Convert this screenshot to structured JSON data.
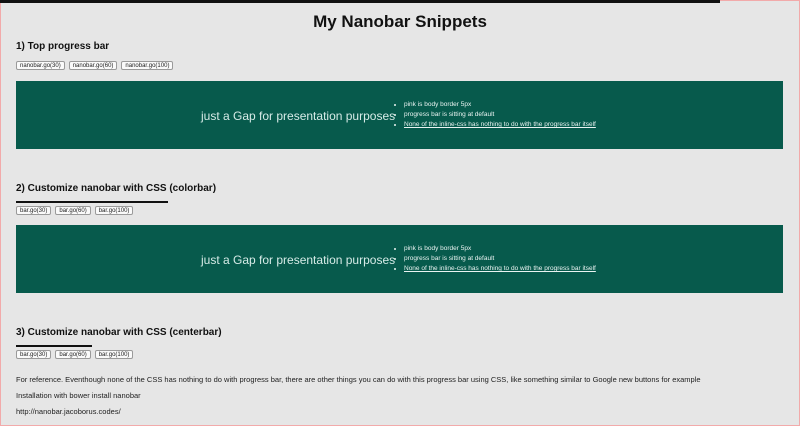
{
  "page": {
    "title": "My Nanobar Snippets",
    "top_nanobar_progress": 0.9
  },
  "sections": [
    {
      "heading": "1) Top progress bar",
      "buttons": [
        "nanobar.go(30)",
        "nanobar.go(60)",
        "nanobar.go(100)"
      ]
    },
    {
      "heading": "2) Customize nanobar with CSS (colorbar)",
      "buttons": [
        "bar.go(30)",
        "bar.go(60)",
        "bar.go(100)"
      ],
      "bar_progress": 0.2
    },
    {
      "heading": "3) Customize nanobar with CSS (centerbar)",
      "buttons": [
        "bar.go(30)",
        "bar.go(60)",
        "bar.go(100)"
      ],
      "bar_progress": 0.1
    }
  ],
  "panel": {
    "gap_text": "just a Gap for presentation purposes",
    "notes": [
      "pink is body border 5px",
      "progress bar is sitting at default",
      "None of the inline-css has nothing to do with the progress bar itself"
    ]
  },
  "footer": {
    "reference": "For reference. Eventhough none of the CSS has nothing to do with progress bar, there are other things you can do with this progress bar using CSS, like something similar to Google new buttons for example",
    "install": "Installation with bower install nanobar",
    "link": "http://nanobar.jacoborus.codes/"
  },
  "colors": {
    "panel": "#075a4c",
    "background": "#e6e6e6",
    "border": "#f2aaaa",
    "bar": "#111111"
  }
}
